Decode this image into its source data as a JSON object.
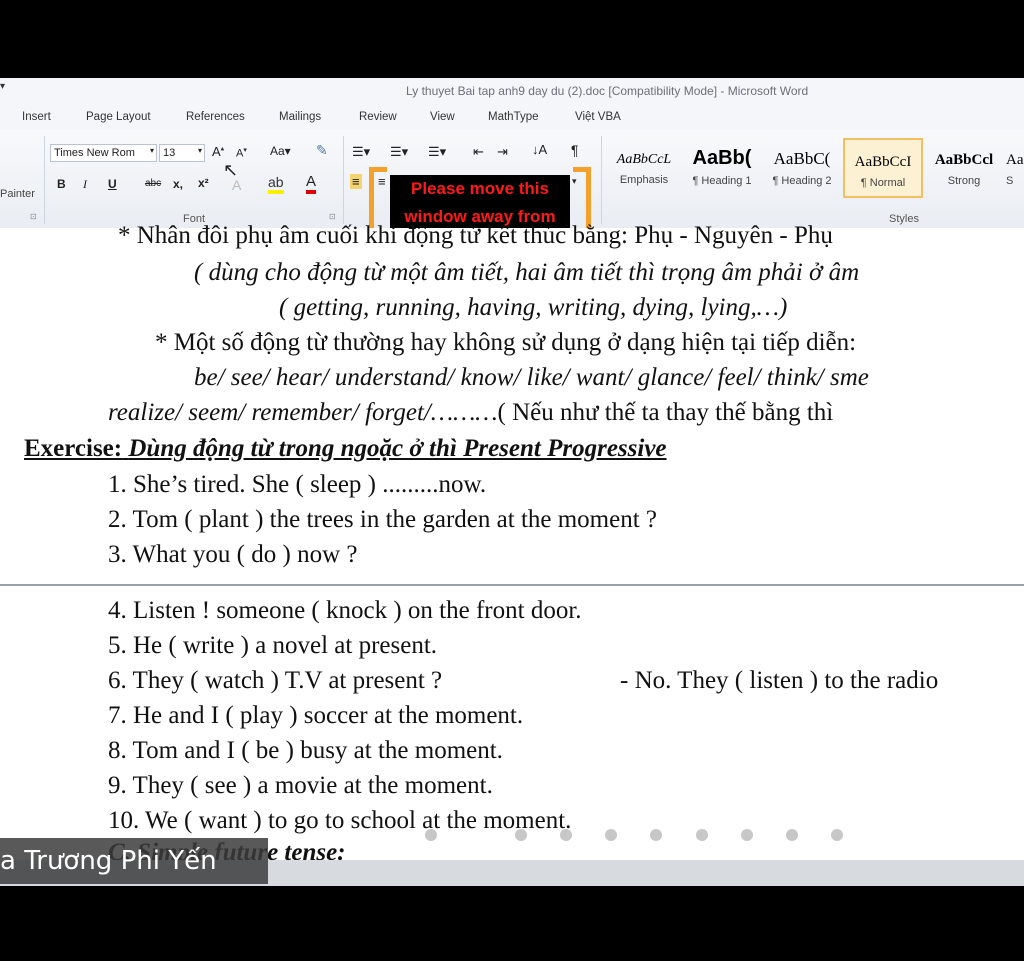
{
  "window": {
    "title": "Ly thuyet Bai tap anh9 day du (2).doc [Compatibility Mode] - Microsoft Word"
  },
  "tabs": [
    "Insert",
    "Page Layout",
    "References",
    "Mailings",
    "Review",
    "View",
    "MathType",
    "Việt VBA"
  ],
  "ribbon": {
    "painter_label": "Painter",
    "font_name": "Times New Rom",
    "font_size": "13",
    "font_group_label": "Font",
    "styles_group_label": "Styles",
    "styles": [
      {
        "sample": "AaBbCcL",
        "name": "Emphasis"
      },
      {
        "sample": "AaBb(",
        "name": "¶ Heading 1"
      },
      {
        "sample": "AaBbC(",
        "name": "¶ Heading 2"
      },
      {
        "sample": "AaBbCcI",
        "name": "¶ Normal"
      },
      {
        "sample": "AaBbCcl",
        "name": "Strong"
      },
      {
        "sample": "Aa",
        "name": "S"
      }
    ]
  },
  "overlay": {
    "line1": "Please move this",
    "line2": "window away from"
  },
  "document": {
    "line0": "*  Nhân đôi phụ âm cuối khi động từ kết thúc bằng: Phụ - Nguyên - Phụ",
    "line1": "( dùng cho động từ một âm tiết, hai âm tiết thì trọng âm phải ở âm",
    "line2": "( getting, running, having, writing, dying, lying,…)",
    "line3": "*  Một số động từ thường hay không sử dụng ở dạng hiện tại tiếp diễn:",
    "line4": "be/ see/ hear/ understand/ know/ like/ want/ glance/ feel/ think/ sme",
    "line5a": "realize/ seem/ remember/ forget/………",
    "line5b": "( Nếu như thế ta thay thế bằng thì",
    "exercise_label": "Exercise:",
    "exercise_title": "Dùng động từ trong ngoặc ở thì Present Progressive",
    "items": [
      "1. She’s tired. She ( sleep ) .........now.",
      "2. Tom ( plant ) the trees in the garden at the moment ?",
      "3. What you ( do ) now ?",
      "4. Listen ! someone ( knock ) on the front door.",
      "5. He ( write ) a novel at present.",
      "6. They ( watch ) T.V at present ?",
      "7. He and I ( play ) soccer at the moment.",
      "8. Tom and I ( be ) busy at the moment.",
      "9. They ( see ) a movie at the moment.",
      "10. We ( want ) to go to school at the moment."
    ],
    "item6_answer": "- No. They ( listen ) to the radio",
    "cut_heading": "C. Simple future tense:"
  },
  "participant_name": "a Trương Phi Yến"
}
